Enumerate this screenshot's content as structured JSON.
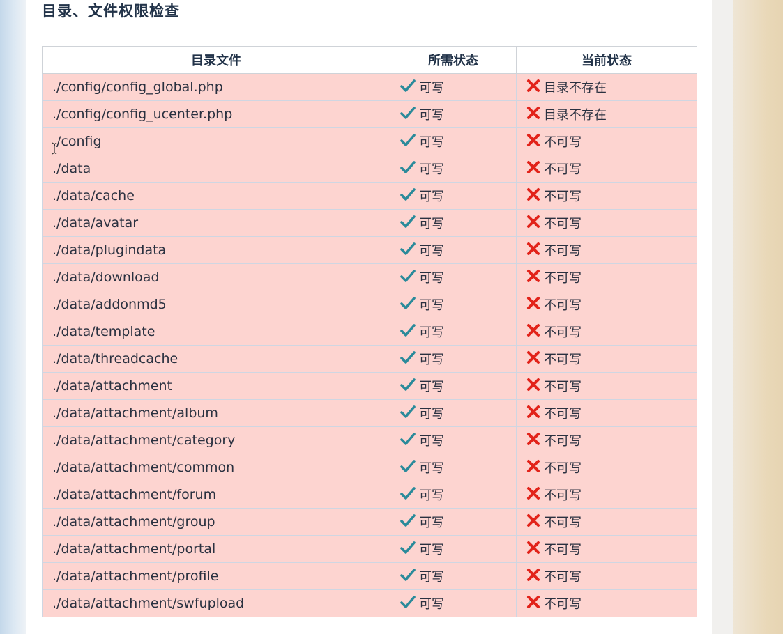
{
  "page": {
    "title": "目录、文件权限检查"
  },
  "colors": {
    "row_error_bg": "#fdd4d0",
    "ok_icon": "#2a8a9a",
    "error_icon": "#e2231a",
    "title_text": "#223349"
  },
  "table": {
    "headers": [
      "目录文件",
      "所需状态",
      "当前状态"
    ],
    "rows": [
      {
        "path": "./config/config_global.php",
        "required": "可写",
        "required_icon": "check-icon",
        "current": "目录不存在",
        "current_icon": "cross-icon"
      },
      {
        "path": "./config/config_ucenter.php",
        "required": "可写",
        "required_icon": "check-icon",
        "current": "目录不存在",
        "current_icon": "cross-icon"
      },
      {
        "path": "./config",
        "required": "可写",
        "required_icon": "check-icon",
        "current": "不可写",
        "current_icon": "cross-icon"
      },
      {
        "path": "./data",
        "required": "可写",
        "required_icon": "check-icon",
        "current": "不可写",
        "current_icon": "cross-icon"
      },
      {
        "path": "./data/cache",
        "required": "可写",
        "required_icon": "check-icon",
        "current": "不可写",
        "current_icon": "cross-icon"
      },
      {
        "path": "./data/avatar",
        "required": "可写",
        "required_icon": "check-icon",
        "current": "不可写",
        "current_icon": "cross-icon"
      },
      {
        "path": "./data/plugindata",
        "required": "可写",
        "required_icon": "check-icon",
        "current": "不可写",
        "current_icon": "cross-icon"
      },
      {
        "path": "./data/download",
        "required": "可写",
        "required_icon": "check-icon",
        "current": "不可写",
        "current_icon": "cross-icon"
      },
      {
        "path": "./data/addonmd5",
        "required": "可写",
        "required_icon": "check-icon",
        "current": "不可写",
        "current_icon": "cross-icon"
      },
      {
        "path": "./data/template",
        "required": "可写",
        "required_icon": "check-icon",
        "current": "不可写",
        "current_icon": "cross-icon"
      },
      {
        "path": "./data/threadcache",
        "required": "可写",
        "required_icon": "check-icon",
        "current": "不可写",
        "current_icon": "cross-icon"
      },
      {
        "path": "./data/attachment",
        "required": "可写",
        "required_icon": "check-icon",
        "current": "不可写",
        "current_icon": "cross-icon"
      },
      {
        "path": "./data/attachment/album",
        "required": "可写",
        "required_icon": "check-icon",
        "current": "不可写",
        "current_icon": "cross-icon"
      },
      {
        "path": "./data/attachment/category",
        "required": "可写",
        "required_icon": "check-icon",
        "current": "不可写",
        "current_icon": "cross-icon"
      },
      {
        "path": "./data/attachment/common",
        "required": "可写",
        "required_icon": "check-icon",
        "current": "不可写",
        "current_icon": "cross-icon"
      },
      {
        "path": "./data/attachment/forum",
        "required": "可写",
        "required_icon": "check-icon",
        "current": "不可写",
        "current_icon": "cross-icon"
      },
      {
        "path": "./data/attachment/group",
        "required": "可写",
        "required_icon": "check-icon",
        "current": "不可写",
        "current_icon": "cross-icon"
      },
      {
        "path": "./data/attachment/portal",
        "required": "可写",
        "required_icon": "check-icon",
        "current": "不可写",
        "current_icon": "cross-icon"
      },
      {
        "path": "./data/attachment/profile",
        "required": "可写",
        "required_icon": "check-icon",
        "current": "不可写",
        "current_icon": "cross-icon"
      },
      {
        "path": "./data/attachment/swfupload",
        "required": "可写",
        "required_icon": "check-icon",
        "current": "不可写",
        "current_icon": "cross-icon"
      }
    ]
  }
}
